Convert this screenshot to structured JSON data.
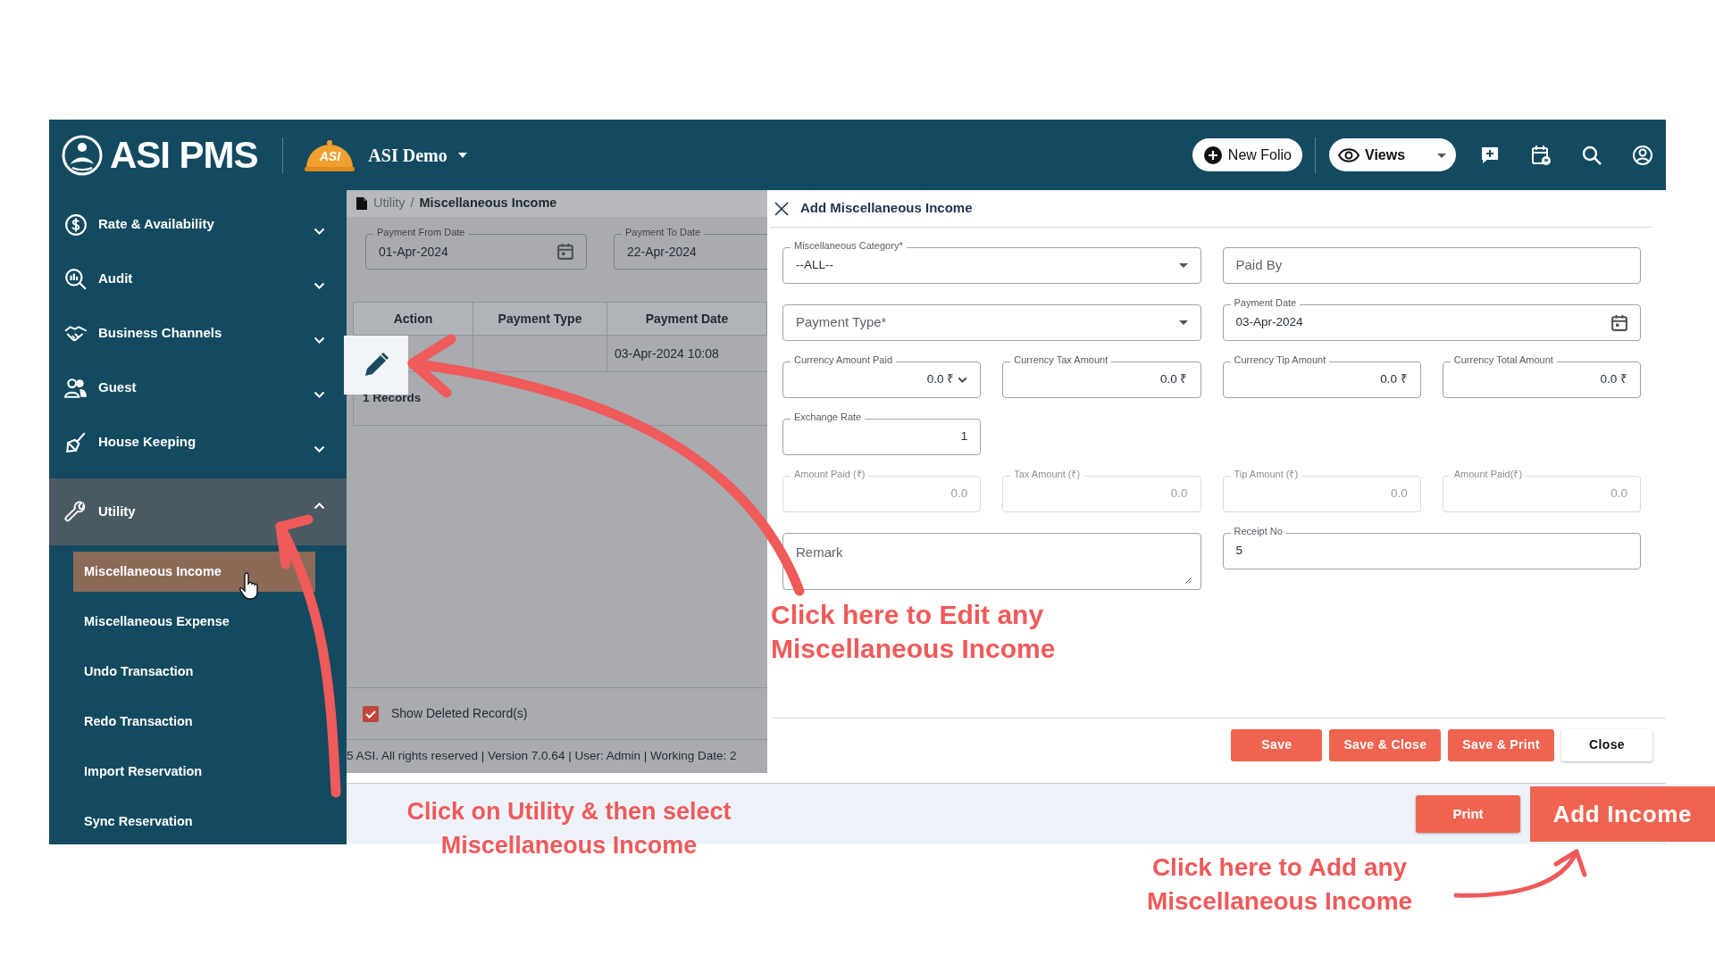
{
  "header": {
    "app_name": "ASI PMS",
    "property_badge": "ASI",
    "property": "ASI Demo",
    "new_folio": "New Folio",
    "views": "Views"
  },
  "sidebar": {
    "items": [
      {
        "label": "Rate & Availability",
        "expanded": false,
        "selected": false
      },
      {
        "label": "Audit",
        "expanded": false,
        "selected": false
      },
      {
        "label": "Business Channels",
        "expanded": false,
        "selected": false
      },
      {
        "label": "Guest",
        "expanded": false,
        "selected": false
      },
      {
        "label": "House Keeping",
        "expanded": false,
        "selected": false
      },
      {
        "label": "Utility",
        "expanded": true,
        "selected": true,
        "children": [
          {
            "label": "Miscellaneous Income",
            "selected": true
          },
          {
            "label": "Miscellaneous Expense",
            "selected": false
          },
          {
            "label": "Undo Transaction",
            "selected": false
          },
          {
            "label": "Redo Transaction",
            "selected": false
          },
          {
            "label": "Import Reservation",
            "selected": false
          },
          {
            "label": "Sync Reservation",
            "selected": false
          }
        ]
      }
    ]
  },
  "breadcrumb": {
    "parent": "Utility",
    "separator": "/",
    "current": "Miscellaneous Income"
  },
  "filters": [
    {
      "label": "Payment From Date",
      "value": "01-Apr-2024"
    },
    {
      "label": "Payment To Date",
      "value": "22-Apr-2024"
    }
  ],
  "table": {
    "columns": [
      "Action",
      "Payment Type",
      "Payment Date"
    ],
    "rows": [
      {
        "payment_date": "03-Apr-2024 10:08"
      }
    ],
    "record_count": "1 Records"
  },
  "show_deleted": {
    "label": "Show Deleted Record(s)",
    "checked": true
  },
  "footer": "5 ASI. All rights reserved | Version 7.0.64 | User: Admin | Working Date: 2",
  "drawer": {
    "title": "Add Miscellaneous Income",
    "rows": [
      [
        {
          "kind": "select",
          "label": "Miscellaneous Category*",
          "value": "--ALL--",
          "disabled": false
        },
        {
          "kind": "text",
          "placeholder": "Paid By",
          "disabled": false
        }
      ],
      [
        {
          "kind": "select",
          "placeholder": "Payment Type*",
          "disabled": false
        },
        {
          "kind": "date",
          "label": "Payment Date",
          "value": "03-Apr-2024",
          "disabled": false
        }
      ],
      [
        {
          "kind": "amount_select",
          "label": "Currency Amount Paid",
          "value": "0.0 ₹",
          "disabled": false
        },
        {
          "kind": "amount",
          "label": "Currency Tax Amount",
          "value": "0.0 ₹",
          "disabled": false
        },
        {
          "kind": "amount",
          "label": "Currency Tip Amount",
          "value": "0.0 ₹",
          "disabled": false
        },
        {
          "kind": "amount",
          "label": "Currency Total Amount",
          "value": "0.0 ₹",
          "disabled": false
        }
      ],
      [
        {
          "kind": "amount",
          "label": "Exchange Rate",
          "value": "1",
          "disabled": false
        }
      ],
      [
        {
          "kind": "amount",
          "label": "Amount Paid (₹)",
          "value": "0.0",
          "disabled": true
        },
        {
          "kind": "amount",
          "label": "Tax Amount (₹)",
          "value": "0.0",
          "disabled": true
        },
        {
          "kind": "amount",
          "label": "Tip Amount (₹)",
          "value": "0.0",
          "disabled": true
        },
        {
          "kind": "amount",
          "label": "Amount Paid(₹)",
          "value": "0.0",
          "disabled": true
        }
      ],
      [
        {
          "kind": "textarea",
          "placeholder": "Remark",
          "disabled": false
        },
        {
          "kind": "text",
          "label": "Receipt No",
          "value": "5",
          "disabled": false
        }
      ]
    ],
    "buttons": [
      {
        "label": "Save",
        "kind": "primary"
      },
      {
        "label": "Save & Close",
        "kind": "primary"
      },
      {
        "label": "Save & Print",
        "kind": "primary"
      },
      {
        "label": "Close",
        "kind": "secondary"
      }
    ]
  },
  "bottom_bar": {
    "print": "Print",
    "add_income": "Add Income"
  },
  "annotations": [
    {
      "kind": "edit",
      "text": "Click here to Edit any\nMiscellaneous Income"
    },
    {
      "kind": "utility",
      "text": "Click on Utility & then select\nMiscellaneous Income"
    },
    {
      "kind": "add",
      "text": "Click here to Add any\nMiscellaneous Income"
    }
  ]
}
